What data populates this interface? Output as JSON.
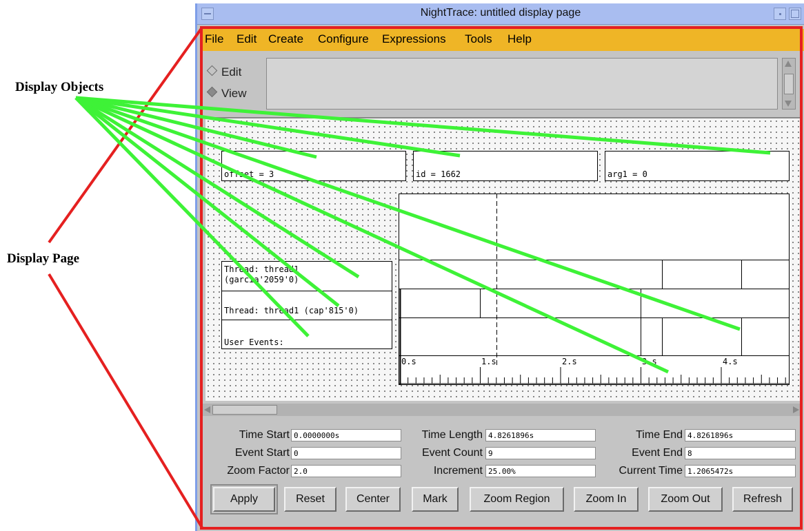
{
  "annotations": {
    "display_objects": "Display Objects",
    "display_page": "Display Page",
    "line_color": "#3ef237",
    "frame_color": "#e52020"
  },
  "window": {
    "title": "NightTrace: untitled display page"
  },
  "menubar": {
    "items": [
      "File",
      "Edit",
      "Create",
      "Configure",
      "Expressions",
      "Tools",
      "Help"
    ]
  },
  "mode": {
    "edit_label": "Edit",
    "view_label": "View",
    "selected": "View"
  },
  "display_objects": {
    "offset_text": "offset = 3",
    "id_text": "id = 1662",
    "arg1_text": "arg1 = 0",
    "thread1_label": [
      "Thread: thread1",
      "(garcia'2059'0)"
    ],
    "thread2_label": "Thread: thread1 (cap'815'0)",
    "user_events_label": "User Events:"
  },
  "timeline": {
    "ticks": [
      "0.s",
      "1.s",
      "2.s",
      "3.s",
      "4.s"
    ]
  },
  "fields": {
    "time_start_label": "Time Start",
    "time_start_value": "0.0000000s",
    "time_length_label": "Time Length",
    "time_length_value": "4.8261896s",
    "time_end_label": "Time End",
    "time_end_value": "4.8261896s",
    "event_start_label": "Event Start",
    "event_start_value": "0",
    "event_count_label": "Event Count",
    "event_count_value": "9",
    "event_end_label": "Event End",
    "event_end_value": "8",
    "zoom_factor_label": "Zoom Factor",
    "zoom_factor_value": "2.0",
    "increment_label": "Increment",
    "increment_value": "25.00%",
    "current_time_label": "Current Time",
    "current_time_value": "1.2065472s"
  },
  "buttons": {
    "apply": "Apply",
    "reset": "Reset",
    "center": "Center",
    "mark": "Mark",
    "zoom_region": "Zoom Region",
    "zoom_in": "Zoom In",
    "zoom_out": "Zoom Out",
    "refresh": "Refresh"
  }
}
